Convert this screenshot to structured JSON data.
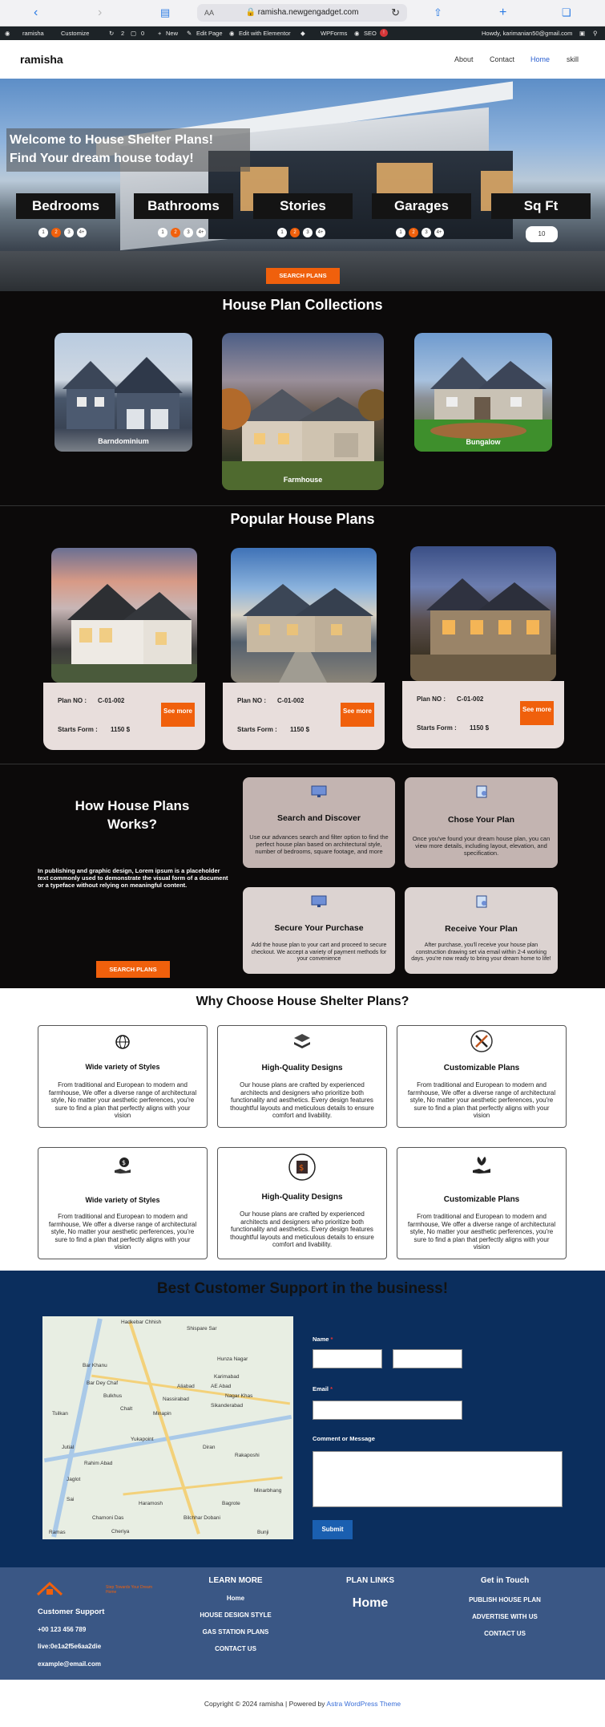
{
  "browser": {
    "url": "ramisha.newgengadget.com",
    "aa": "AA"
  },
  "adminbar": {
    "site": "ramisha",
    "customize": "Customize",
    "updates": "2",
    "comments": "0",
    "new": "New",
    "edit_page": "Edit Page",
    "elementor": "Edit with Elementor",
    "wpforms": "WPForms",
    "seo": "SEO",
    "howdy": "Howdy, karimanian50@gmail.com"
  },
  "header": {
    "logo": "ramisha",
    "nav": [
      "About",
      "Contact",
      "Home",
      "skill"
    ]
  },
  "hero": {
    "title_line1": "Welcome to House Shelter Plans!",
    "title_line2": "Find Your dream house today!",
    "filters": [
      {
        "label": "Bedrooms",
        "options": [
          "1",
          "2",
          "3",
          "4+"
        ],
        "selected": "2"
      },
      {
        "label": "Bathrooms",
        "options": [
          "1",
          "2",
          "3",
          "4+"
        ],
        "selected": "2"
      },
      {
        "label": "Stories",
        "options": [
          "1",
          "2",
          "3",
          "4+"
        ],
        "selected": "2"
      },
      {
        "label": "Garages",
        "options": [
          "1",
          "2",
          "3",
          "4+"
        ],
        "selected": "2"
      },
      {
        "label": "Sq Ft",
        "value": "10"
      }
    ],
    "search_button": "SEARCH PLANS"
  },
  "collections": {
    "title": "House Plan Collections",
    "items": [
      "Barndominium",
      "Farmhouse",
      "Bungalow"
    ]
  },
  "popular": {
    "title": "Popular House Plans",
    "items": [
      {
        "plan_label": "Plan NO :",
        "plan_no": "C-01-002",
        "starts_label": "Starts Form :",
        "price": "1150 $",
        "button": "See more"
      },
      {
        "plan_label": "Plan NO :",
        "plan_no": "C-01-002",
        "starts_label": "Starts Form :",
        "price": "1150 $",
        "button": "See more"
      },
      {
        "plan_label": "Plan NO :",
        "plan_no": "C-01-002",
        "starts_label": "Starts Form :",
        "price": "1150 $",
        "button": "See more"
      }
    ]
  },
  "how": {
    "title": "How House Plans Works?",
    "body": "In publishing and graphic design, Lorem ipsum is a placeholder text commonly used to demonstrate the visual form of a document or a typeface without relying on meaningful content.",
    "button": "SEARCH PLANS",
    "steps": [
      {
        "title": "Search and Discover",
        "desc": "Use our advances search and filter option to find the perfect house plan based on architectural style, number of bedrooms, square footage, and more"
      },
      {
        "title": "Chose Your Plan",
        "desc": "Once you've found your dream house plan, you can view more details, including layout, elevation, and specification."
      },
      {
        "title": "Secure Your Purchase",
        "desc": "Add the house plan to your cart and proceed to secure checkout. We accept a variety of payment methods for your convenience"
      },
      {
        "title": "Receive Your Plan",
        "desc": "After purchase, you'll receive your house plan construction drawing set via email within 2-4 working days. you're now ready to bring your dream home to life!"
      }
    ]
  },
  "why": {
    "title": "Why Choose House Shelter Plans?",
    "cards": [
      {
        "title": "Wide variety of Styles",
        "desc": "From traditional and European to modern and farmhouse, We offer a diverse range of architectural style, No matter your aesthetic perferences, you're sure to find a plan that perfectly aligns with your vision",
        "icon": "globe-icon"
      },
      {
        "title": "High-Quality Designs",
        "desc": "Our house plans are crafted by experienced architects and designers who prioritize both functionality and aesthetics. Every design features thoughtful layouts and meticulous details to ensure comfort and livability.",
        "icon": "layers-icon"
      },
      {
        "title": "Customizable Plans",
        "desc": "From traditional and European to modern and farmhouse, We offer a diverse range of architectural style, No matter your aesthetic perferences, you're sure to find a plan that perfectly aligns with your vision",
        "icon": "tools-icon"
      },
      {
        "title": "Wide variety of Styles",
        "desc": "From traditional and European to modern and farmhouse, We offer a diverse range of architectural style, No matter your aesthetic perferences, you're sure to find a plan that perfectly aligns with your vision",
        "icon": "money-hand-icon"
      },
      {
        "title": "High-Quality Designs",
        "desc": "Our house plans are crafted by experienced architects and designers who prioritize both functionality and aesthetics. Every design features thoughtful layouts and meticulous details to ensure comfort and livability.",
        "icon": "dollar-badge-icon"
      },
      {
        "title": "Customizable Plans",
        "desc": "From traditional and European to modern and farmhouse, We offer a diverse range of architectural style, No matter your aesthetic perferences, you're sure to find a plan that perfectly aligns with your vision",
        "icon": "plant-hand-icon"
      }
    ]
  },
  "support": {
    "title": "Best Customer Support in the business!",
    "map_labels": [
      "Hadkebar Chhish",
      "Shispare Sar",
      "Hunza Nagar",
      "Bar Khanu",
      "Karimabad",
      "Bar Dey Chaf",
      "Aliabad",
      "AE Abad",
      "Nagar Khas",
      "Nassirabad",
      "Bulkhus",
      "Sikanderabad",
      "Chalt",
      "Minapin",
      "Tsilkan",
      "Yukapoint",
      "Diran",
      "Jutial",
      "Rakaposhi",
      "Rahim Abad",
      "Jaglot",
      "Bilchhar Dobani",
      "Haramosh",
      "Chamoni Das",
      "Bagrote",
      "Minarbhang",
      "Sai",
      "Cheriya",
      "Ramas",
      "Bunji"
    ],
    "name_label": "Name",
    "email_label": "Email",
    "message_label": "Comment or Message",
    "required_mark": "*",
    "submit": "Submit"
  },
  "footer": {
    "brand_tag": "Step Towards Your Dream Home",
    "support_title": "Customer Support",
    "phone": "+00 123 456 789",
    "live": "live:0e1a2f5e6aa2die",
    "email": "example@email.com",
    "learn_title": "LEARN MORE",
    "learn_links": [
      "Home",
      "HOUSE DESIGN STYLE",
      "GAS STATION PLANS",
      "CONTACT US"
    ],
    "plan_title": "PLAN LINKS",
    "plan_home": "Home",
    "touch_title": "Get in Touch",
    "touch_links": [
      "PUBLISH HOUSE PLAN",
      "ADVERTISE WITH US",
      "CONTACT US"
    ]
  },
  "copyright": {
    "text": "Copyright © 2024 ramisha | Powered by ",
    "link": "Astra WordPress Theme"
  },
  "colors": {
    "accent": "#f0600c",
    "dark": "#0c0a0a",
    "support_bg": "#0b2e5d",
    "footer_bg": "#3a5785"
  }
}
